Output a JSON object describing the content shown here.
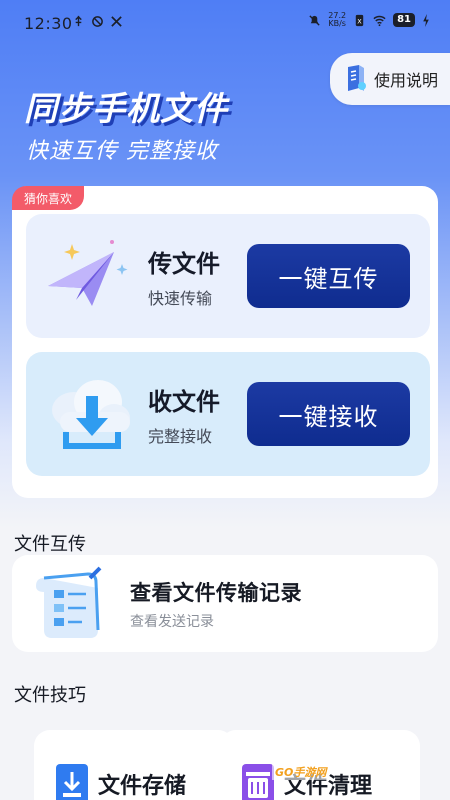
{
  "status_bar": {
    "time": "12:30",
    "net_speed_value": "27.2",
    "net_speed_unit": "KB/s",
    "battery": "81"
  },
  "help": {
    "label": "使用说明"
  },
  "hero": {
    "title": "同步手机文件",
    "subtitle": "快速互传 完整接收"
  },
  "card": {
    "tag": "猜你喜欢",
    "send": {
      "title": "传文件",
      "desc": "快速传输",
      "button": "一键互传"
    },
    "receive": {
      "title": "收文件",
      "desc": "完整接收",
      "button": "一键接收"
    }
  },
  "transfer_section": {
    "title": "文件互传",
    "record": {
      "title": "查看文件传输记录",
      "subtitle": "查看发送记录"
    }
  },
  "tips_section": {
    "title": "文件技巧",
    "items": [
      {
        "label": "文件存储"
      },
      {
        "label": "文件清理"
      }
    ]
  },
  "watermark": "GO手游网",
  "colors": {
    "primary_button": "#1c3aa3",
    "tag": "#f35b69",
    "hero_shadow": "#1f3fb5"
  }
}
